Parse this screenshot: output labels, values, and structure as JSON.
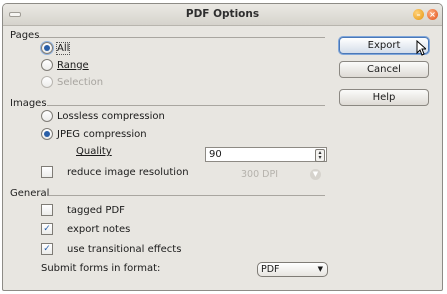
{
  "window": {
    "title": "PDF Options"
  },
  "pages": {
    "heading": "Pages",
    "options": [
      {
        "label": "All",
        "checked": true,
        "enabled": true
      },
      {
        "label": "Range",
        "checked": false,
        "enabled": true
      },
      {
        "label": "Selection",
        "checked": false,
        "enabled": false
      }
    ]
  },
  "images": {
    "heading": "Images",
    "lossless_label": "Lossless compression",
    "jpeg_label": "JPEG compression",
    "quality_label": "Quality",
    "quality_value": "90",
    "reduce_label": "reduce image resolution",
    "dpi_value": "300 DPI"
  },
  "general": {
    "heading": "General",
    "tagged_pdf_label": "tagged PDF",
    "tagged_pdf_checked": false,
    "export_notes_label": "export notes",
    "export_notes_checked": true,
    "transitional_label": "use transitional effects",
    "transitional_checked": true,
    "submit_label": "Submit forms in format:",
    "submit_value": "PDF"
  },
  "buttons": {
    "export": "Export",
    "cancel": "Cancel",
    "help": "Help"
  },
  "colors": {
    "accent": "#2a5fa8",
    "window_bg": "#e8e6e1"
  }
}
